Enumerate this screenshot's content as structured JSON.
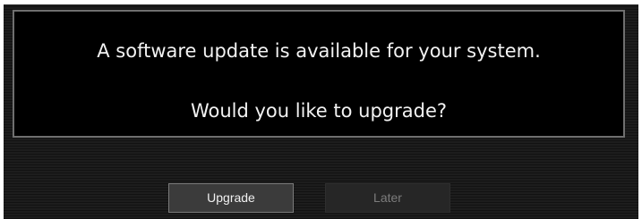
{
  "dialog": {
    "message_line1": "A software update is available for your system.",
    "message_line2": "Would you like to upgrade?"
  },
  "buttons": {
    "upgrade_label": "Upgrade",
    "later_label": "Later"
  },
  "colors": {
    "dialog_background": "#000000",
    "dialog_border": "#6f6f6f",
    "screen_background": "#1a1a1a",
    "focused_button": "#3b3b3b",
    "unfocused_button": "#262626"
  }
}
